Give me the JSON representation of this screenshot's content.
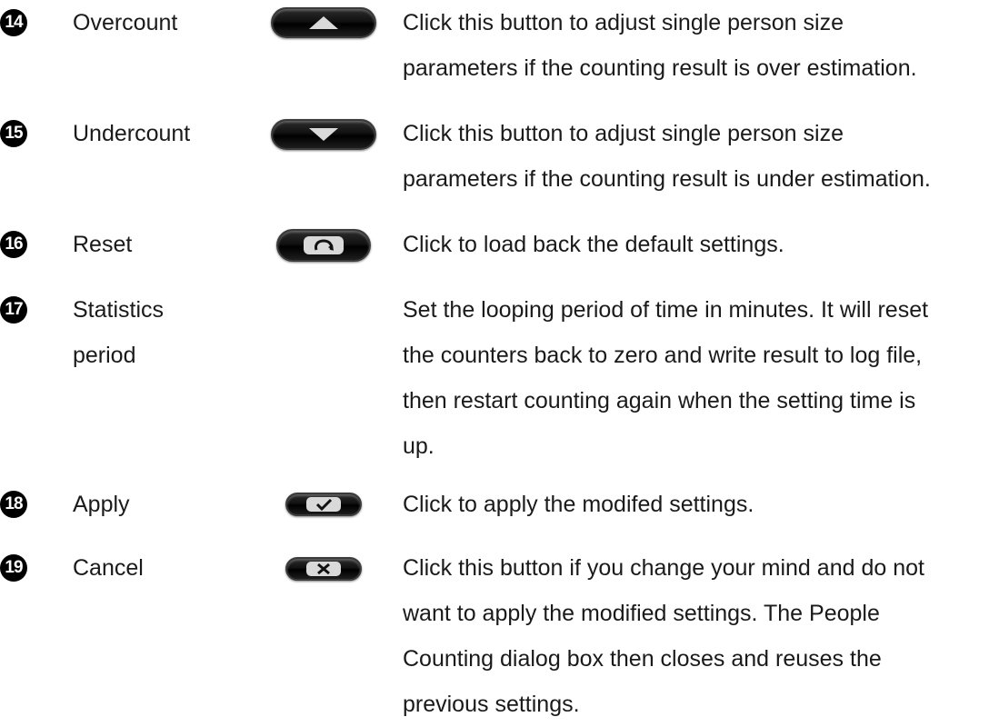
{
  "items": [
    {
      "num": "14",
      "label": "Overcount",
      "button_icon": "up-arrow-icon",
      "desc": "Click this button to adjust single person size\nparameters if the counting result is over estimation."
    },
    {
      "num": "15",
      "label": "Undercount",
      "button_icon": "down-arrow-icon",
      "desc": "Click this button to adjust single person size\nparameters if the counting result is under estimation."
    },
    {
      "num": "16",
      "label": "Reset",
      "button_icon": "reset-icon",
      "desc": "Click to load back the default settings."
    },
    {
      "num": "17",
      "label": "Statistics\nperiod",
      "button_icon": "",
      "desc": "Set the looping period of time in minutes. It will reset\nthe counters back to zero and write result to log file,\nthen restart counting again when the setting time is\nup."
    },
    {
      "num": "18",
      "label": "Apply",
      "button_icon": "check-icon",
      "desc": "Click to apply the modifed settings."
    },
    {
      "num": "19",
      "label": "Cancel",
      "button_icon": "x-icon",
      "desc": "Click this button if you change your mind and do not\nwant to apply the modified settings. The People\nCounting dialog box then closes and reuses the\nprevious settings."
    }
  ]
}
